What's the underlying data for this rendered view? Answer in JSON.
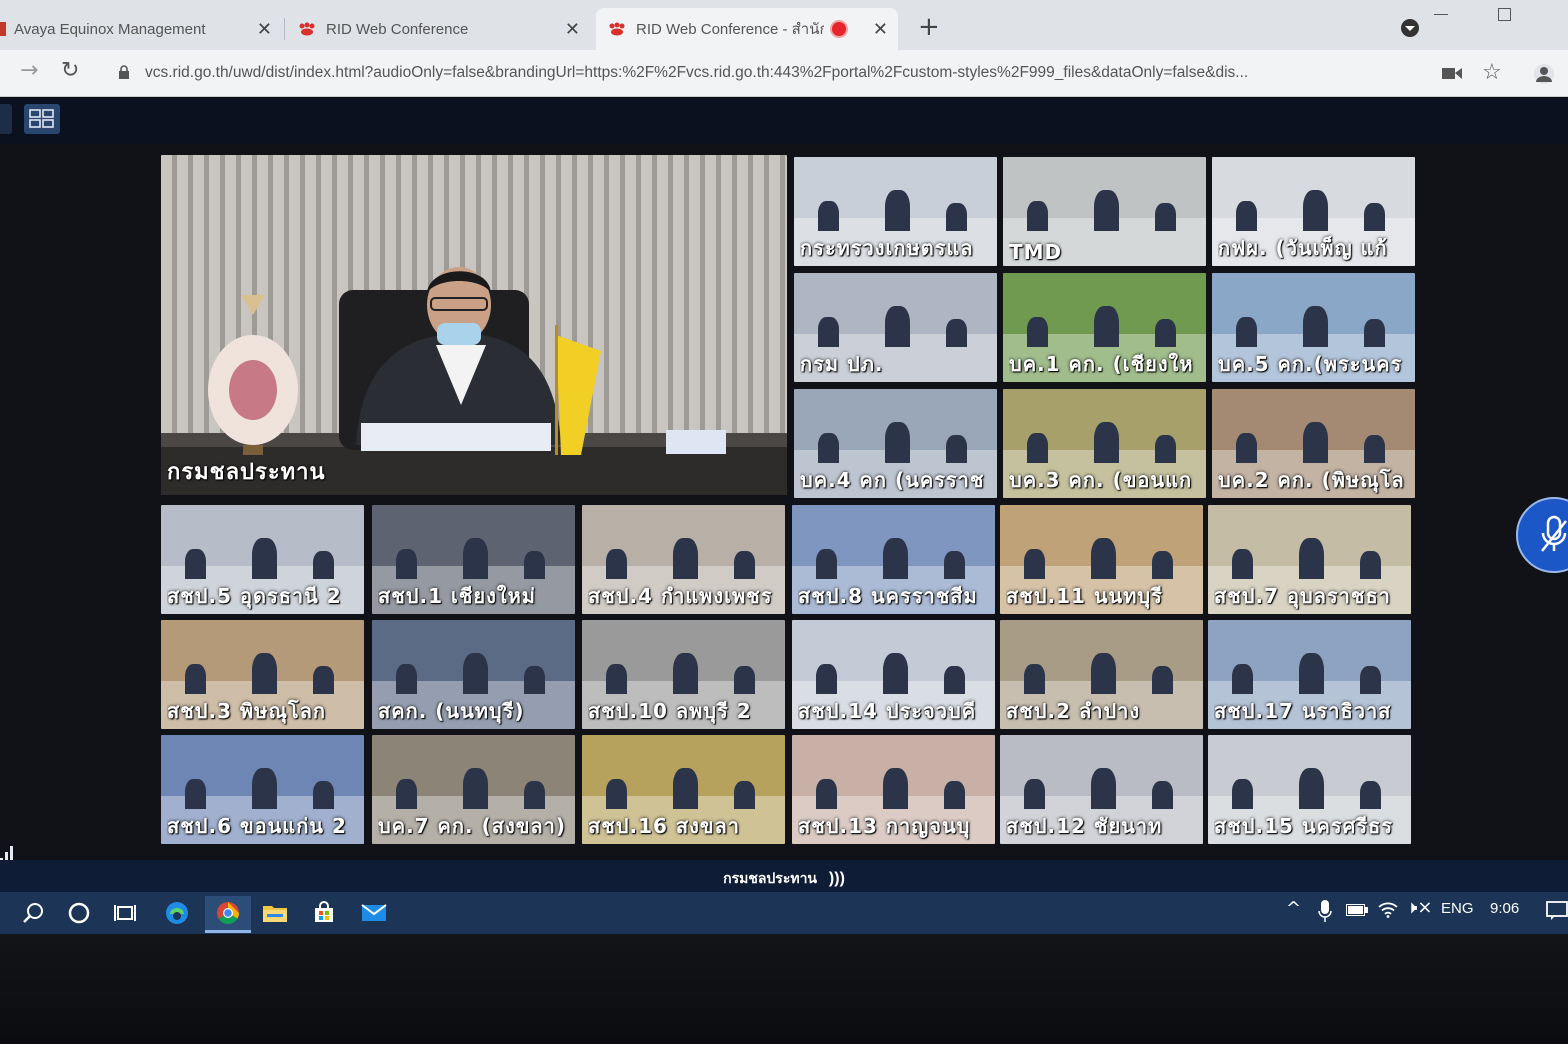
{
  "browser": {
    "tabs": [
      {
        "title": "Avaya Equinox Management",
        "icon": "red-favicon"
      },
      {
        "title": "RID Web Conference",
        "icon": "paw-icon"
      },
      {
        "title": "RID Web Conference - สำนัก",
        "icon": "paw-icon",
        "active": true,
        "recording": true
      }
    ],
    "new_tab": "+",
    "url": "vcs.rid.go.th/uwd/dist/index.html?audioOnly=false&brandingUrl=https:%2F%2Fvcs.rid.go.th:443%2Fportal%2Fcustom-styles%2F999_files&dataOnly=false&dis..."
  },
  "conference": {
    "main_tile": {
      "label": "กรมชลประทาน"
    },
    "tiles": [
      {
        "label": "กระทรวงเกษตรแล",
        "bg": "#c9cfd8"
      },
      {
        "label": "TMD",
        "bg": "#bfc3c4"
      },
      {
        "label": "กฟผ. (วันเพ็ญ แก้",
        "bg": "#d7dbe0"
      },
      {
        "label": "กรม ปภ.",
        "bg": "#aeb6c4"
      },
      {
        "label": "บค.1 คก. (เชียงให",
        "bg": "#6f9a4f"
      },
      {
        "label": "บค.5 คก.(พระนคร",
        "bg": "#8aa7c7"
      },
      {
        "label": "บค.4 คก (นครราช",
        "bg": "#9aa7b8"
      },
      {
        "label": "บค.3 คก. (ขอนแก",
        "bg": "#a7a06a"
      },
      {
        "label": "บค.2 คก. (พิษณุโล",
        "bg": "#a48a72"
      },
      {
        "label": "สชป.5 อุดรธานี 2",
        "bg": "#b6bdc8"
      },
      {
        "label": "สชป.1 เชียงใหม่",
        "bg": "#5d6370"
      },
      {
        "label": "สชป.4 กำแพงเพชร",
        "bg": "#b8b0a6"
      },
      {
        "label": "สชป.8 นครราชสีม",
        "bg": "#7f97c0"
      },
      {
        "label": "สชป.11 นนทบุรี",
        "bg": "#c0a278"
      },
      {
        "label": "สชป.7 อุบลราชธา",
        "bg": "#c4bca4"
      },
      {
        "label": "สชป.3 พิษณุโลก",
        "bg": "#b49a78"
      },
      {
        "label": "สคก. (นนทบุรี)",
        "bg": "#5b6b86"
      },
      {
        "label": "สชป.10 ลพบุรี 2",
        "bg": "#9a9a9a"
      },
      {
        "label": "สชป.14 ประจวบคี",
        "bg": "#c3ccd6"
      },
      {
        "label": "สชป.2 ลำปาง",
        "bg": "#a99c86"
      },
      {
        "label": "สชป.17 นราธิวาส",
        "bg": "#8ea3c2"
      },
      {
        "label": "สชป.6 ขอนแก่น 2",
        "bg": "#6d86b4"
      },
      {
        "label": "บค.7 คก. (สงขลา)",
        "bg": "#8d8478"
      },
      {
        "label": "สชป.16 สงขลา",
        "bg": "#b6a25c"
      },
      {
        "label": "สชป.13 กาญจนบุ",
        "bg": "#c9b0a6"
      },
      {
        "label": "สชป.12 ชัยนาท",
        "bg": "#b9bcc4"
      },
      {
        "label": "สชป.15 นครศรีธร",
        "bg": "#c8ccd2"
      }
    ],
    "active_speaker": "กรมชลประทาน"
  },
  "taskbar": {
    "apps": [
      "search-icon",
      "cortana-icon",
      "task-view-icon",
      "edge-icon",
      "chrome-icon",
      "file-explorer-icon",
      "store-icon",
      "mail-icon"
    ],
    "language": "ENG",
    "time": "9:06"
  }
}
